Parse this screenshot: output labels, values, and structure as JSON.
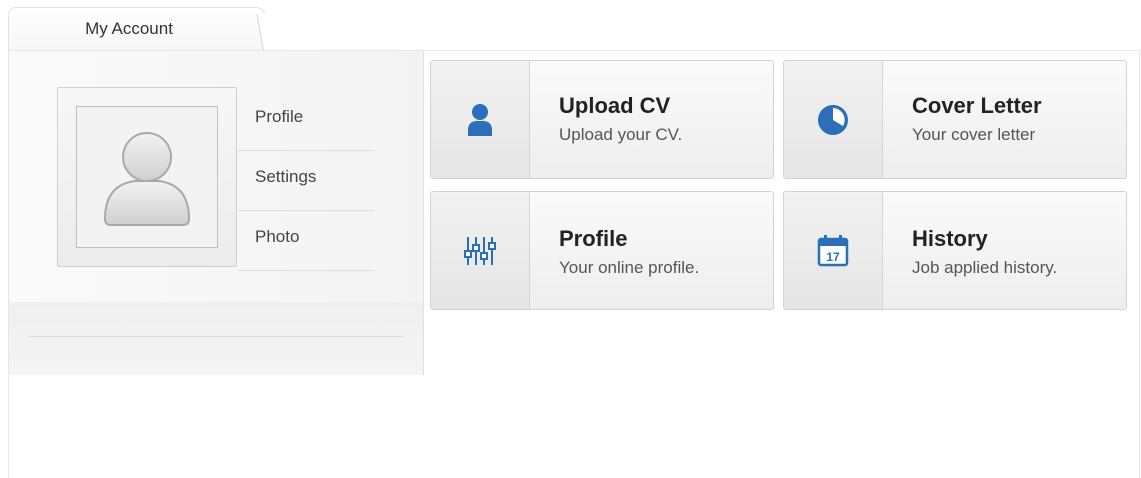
{
  "tab": {
    "label": "My Account"
  },
  "menu": {
    "items": [
      {
        "label": "Profile"
      },
      {
        "label": "Settings"
      },
      {
        "label": "Photo"
      }
    ]
  },
  "cards": [
    {
      "title": "Upload CV",
      "desc": "Upload your CV.",
      "icon": "user-icon"
    },
    {
      "title": "Cover Letter",
      "desc": "Your cover letter",
      "icon": "pie-chart-icon"
    },
    {
      "title": "Profile",
      "desc": "Your online profile.",
      "icon": "sliders-icon"
    },
    {
      "title": "History",
      "desc": "Job applied history.",
      "icon": "calendar-icon",
      "icon_text": "17"
    }
  ],
  "colors": {
    "icon_blue": "#2a6fb8",
    "card_border": "#d3d3d3"
  }
}
